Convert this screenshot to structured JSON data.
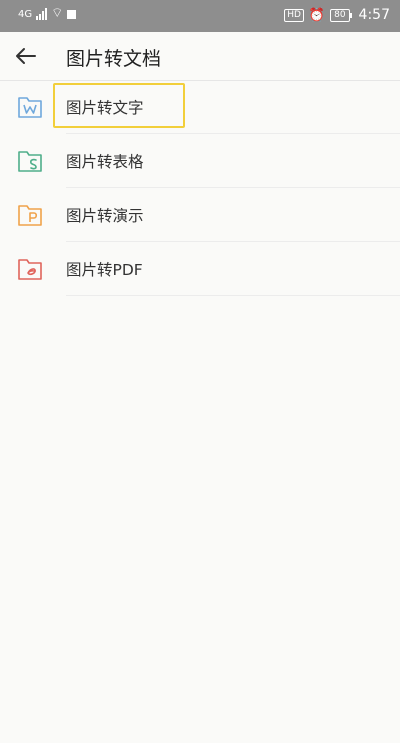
{
  "status_bar": {
    "time": "4:57",
    "battery": "80",
    "hd_label": "HD",
    "network_label": "4G"
  },
  "app_bar": {
    "title": "图片转文档"
  },
  "items": [
    {
      "label": "图片转文字",
      "icon": "doc-word-icon",
      "color": "#6fa8dc",
      "selected": true
    },
    {
      "label": "图片转表格",
      "icon": "doc-sheet-icon",
      "color": "#4fae8a",
      "selected": false
    },
    {
      "label": "图片转演示",
      "icon": "doc-slides-icon",
      "color": "#f0a24a",
      "selected": false
    },
    {
      "label": "图片转PDF",
      "icon": "doc-pdf-icon",
      "color": "#e0645c",
      "selected": false
    }
  ]
}
